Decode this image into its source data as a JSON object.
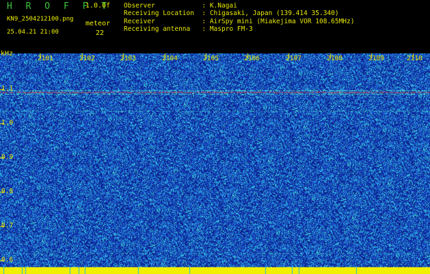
{
  "header": {
    "app_title": "H R O F F T",
    "version": "1.0.0f",
    "filename": "KN9_2504212100.png",
    "meteor_label": "meteor",
    "datetime": "25.04.21 21:00",
    "count": "22"
  },
  "info": {
    "observer": "Observer            : K.Nagai",
    "location": "Receiving Location  : Chigasaki, Japan (139.414 35.340)",
    "receiver": "Receiver            : AirSpy mini (Miakejima VOR 108.65MHz)",
    "antenna": "Receiving antenna   : Maspro FM-3"
  },
  "chart_data": {
    "type": "heatmap",
    "ylabel": "kHz",
    "y_ticks": [
      "1.1",
      "1.0",
      "0.9",
      "0.8",
      "0.7",
      "0.6"
    ],
    "x_ticks": [
      "2101",
      "2102",
      "2103",
      "2104",
      "2105",
      "2106",
      "2107",
      "2108",
      "2109",
      "2110"
    ],
    "colors": {
      "background": "#0a1e8c",
      "noise_low": "#1e5ad2",
      "noise_mid": "#28b4e6",
      "noise_high": "#50e6d2",
      "carrier": "#e65a50",
      "floor": "#f0f000"
    }
  }
}
